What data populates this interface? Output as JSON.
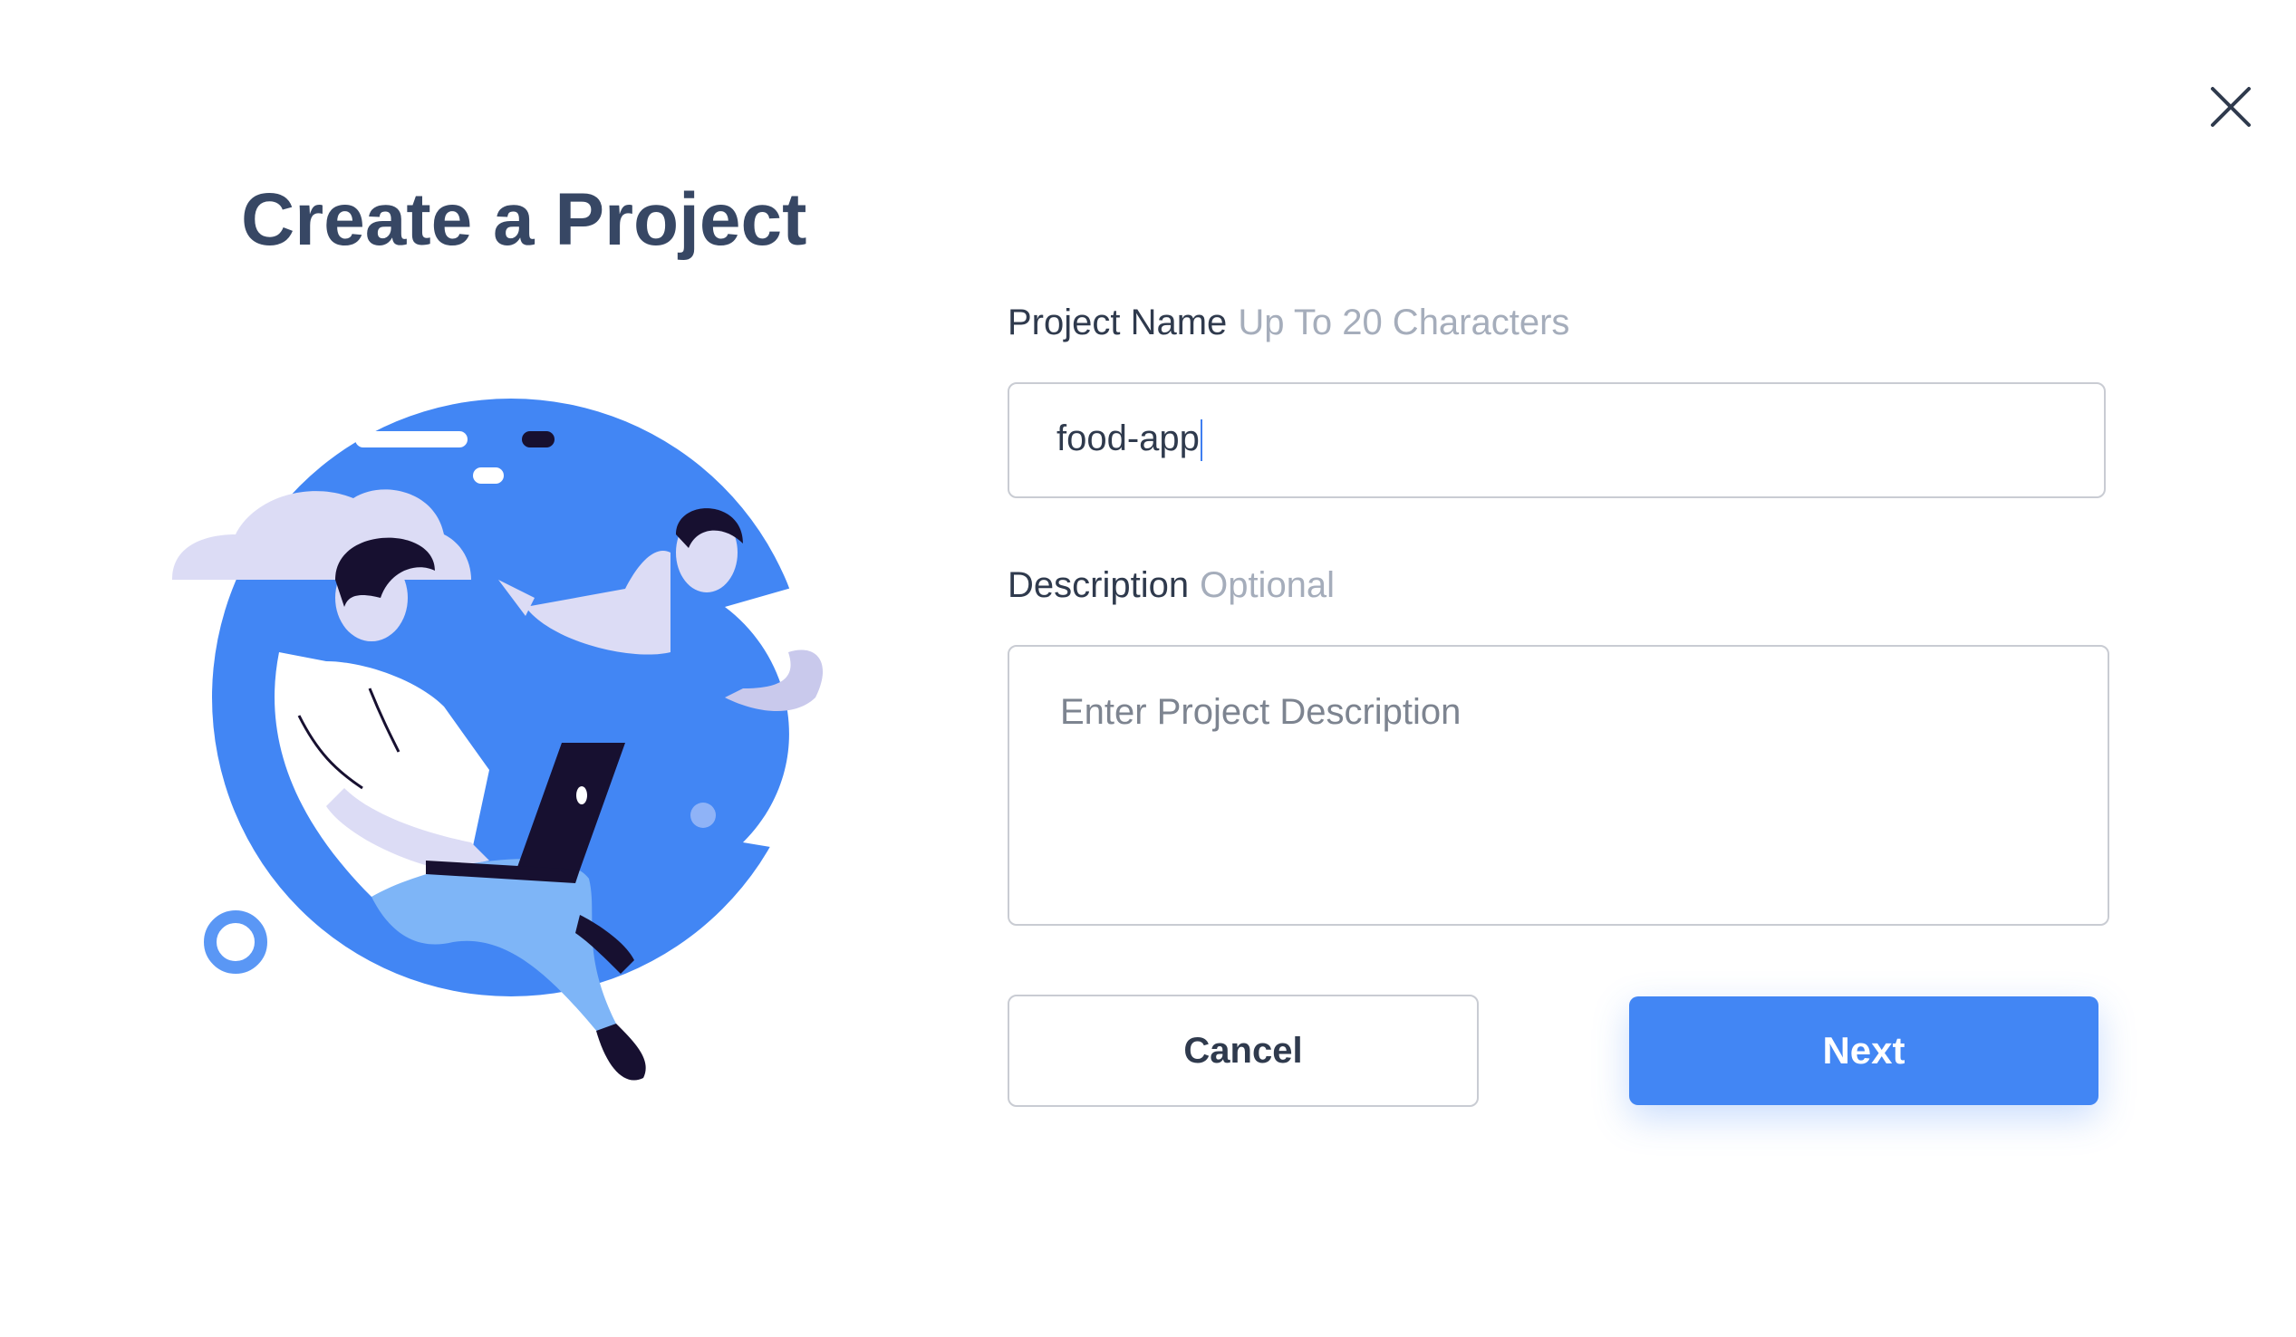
{
  "dialog": {
    "title": "Create a Project",
    "close_icon": "close-icon"
  },
  "illustration": {
    "description_icon": "people-with-laptop-illustration"
  },
  "form": {
    "project_name": {
      "label": "Project Name",
      "hint": "Up To 20 Characters",
      "value": "food-app"
    },
    "description": {
      "label": "Description",
      "hint": "Optional",
      "placeholder": "Enter Project Description",
      "value": ""
    }
  },
  "buttons": {
    "cancel_label": "Cancel",
    "next_label": "Next"
  },
  "colors": {
    "accent": "#4286f4",
    "title": "#374764",
    "hint": "#a5adbb",
    "border": "#c9ccd3"
  }
}
